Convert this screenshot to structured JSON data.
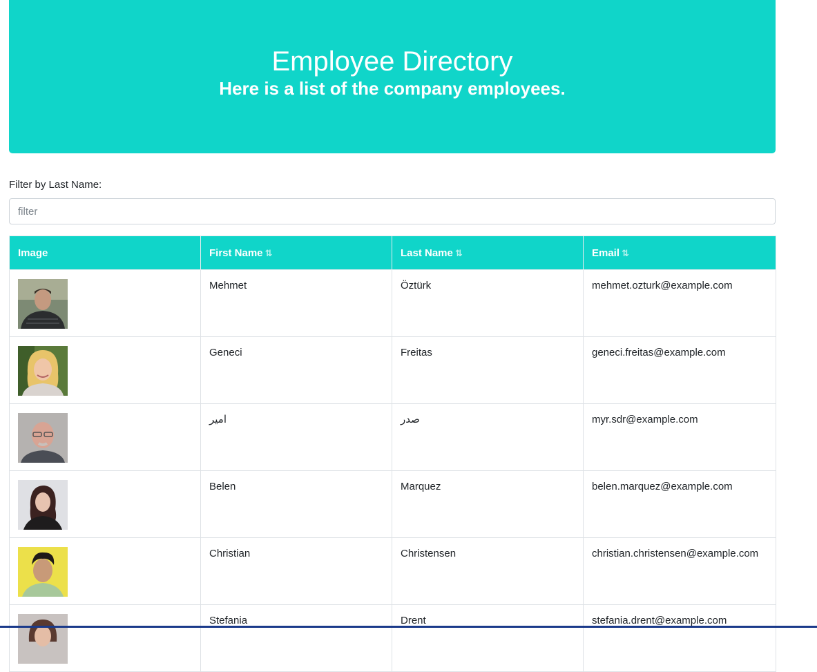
{
  "header": {
    "title": "Employee Directory",
    "subtitle": "Here is a list of the company employees.",
    "background": "#10d5c9"
  },
  "filter": {
    "label": "Filter by Last Name:",
    "placeholder": "filter",
    "value": ""
  },
  "table": {
    "columns": [
      {
        "label": "Image",
        "sortable": false
      },
      {
        "label": "First Name",
        "sortable": true
      },
      {
        "label": "Last Name",
        "sortable": true
      },
      {
        "label": "Email",
        "sortable": true
      }
    ],
    "sort_icon": "sort-up-down-icon",
    "rows": [
      {
        "avatar": "avatar-photo",
        "first": "Mehmet",
        "last": "Öztürk",
        "email": "mehmet.ozturk@example.com"
      },
      {
        "avatar": "avatar-photo",
        "first": "Geneci",
        "last": "Freitas",
        "email": "geneci.freitas@example.com"
      },
      {
        "avatar": "avatar-photo",
        "first": "امیر",
        "last": "صدر",
        "email": "myr.sdr@example.com"
      },
      {
        "avatar": "avatar-photo",
        "first": "Belen",
        "last": "Marquez",
        "email": "belen.marquez@example.com"
      },
      {
        "avatar": "avatar-photo",
        "first": "Christian",
        "last": "Christensen",
        "email": "christian.christensen@example.com"
      },
      {
        "avatar": "avatar-photo",
        "first": "Stefania",
        "last": "Drent",
        "email": "stefania.drent@example.com"
      }
    ]
  }
}
